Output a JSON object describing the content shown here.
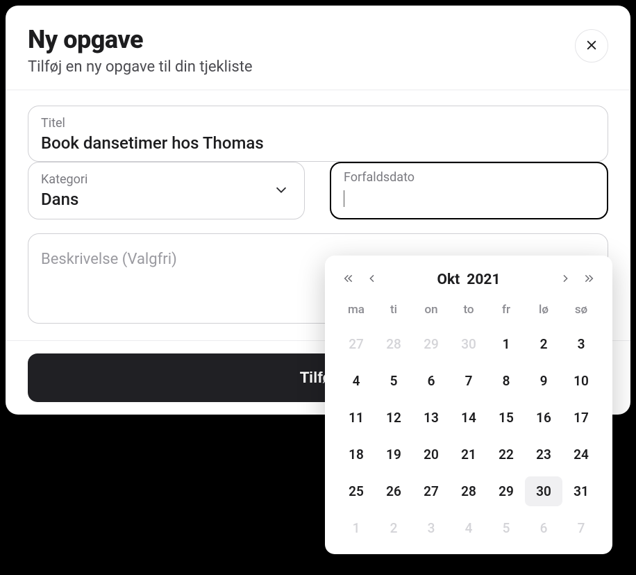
{
  "modal": {
    "title": "Ny opgave",
    "subtitle": "Tilføj en ny opgave til din tjekliste"
  },
  "fields": {
    "title_label": "Titel",
    "title_value": "Book dansetimer hos Thomas",
    "category_label": "Kategori",
    "category_value": "Dans",
    "duedate_label": "Forfaldsdato",
    "duedate_value": "",
    "description_placeholder": "Beskrivelse (Valgfri)"
  },
  "submit_label": "Tilføj",
  "datepicker": {
    "month_label": "Okt",
    "year_label": "2021",
    "dow": [
      "ma",
      "ti",
      "on",
      "to",
      "fr",
      "lø",
      "sø"
    ],
    "weeks": [
      [
        {
          "d": "27",
          "outside": true
        },
        {
          "d": "28",
          "outside": true
        },
        {
          "d": "29",
          "outside": true
        },
        {
          "d": "30",
          "outside": true
        },
        {
          "d": "1"
        },
        {
          "d": "2"
        },
        {
          "d": "3"
        }
      ],
      [
        {
          "d": "4"
        },
        {
          "d": "5"
        },
        {
          "d": "6"
        },
        {
          "d": "7"
        },
        {
          "d": "8"
        },
        {
          "d": "9"
        },
        {
          "d": "10"
        }
      ],
      [
        {
          "d": "11"
        },
        {
          "d": "12"
        },
        {
          "d": "13"
        },
        {
          "d": "14"
        },
        {
          "d": "15"
        },
        {
          "d": "16"
        },
        {
          "d": "17"
        }
      ],
      [
        {
          "d": "18"
        },
        {
          "d": "19"
        },
        {
          "d": "20"
        },
        {
          "d": "21"
        },
        {
          "d": "22"
        },
        {
          "d": "23"
        },
        {
          "d": "24"
        }
      ],
      [
        {
          "d": "25"
        },
        {
          "d": "26"
        },
        {
          "d": "27"
        },
        {
          "d": "28"
        },
        {
          "d": "29"
        },
        {
          "d": "30",
          "today": true
        },
        {
          "d": "31"
        }
      ],
      [
        {
          "d": "1",
          "outside": true
        },
        {
          "d": "2",
          "outside": true
        },
        {
          "d": "3",
          "outside": true
        },
        {
          "d": "4",
          "outside": true
        },
        {
          "d": "5",
          "outside": true
        },
        {
          "d": "6",
          "outside": true
        },
        {
          "d": "7",
          "outside": true
        }
      ]
    ]
  }
}
